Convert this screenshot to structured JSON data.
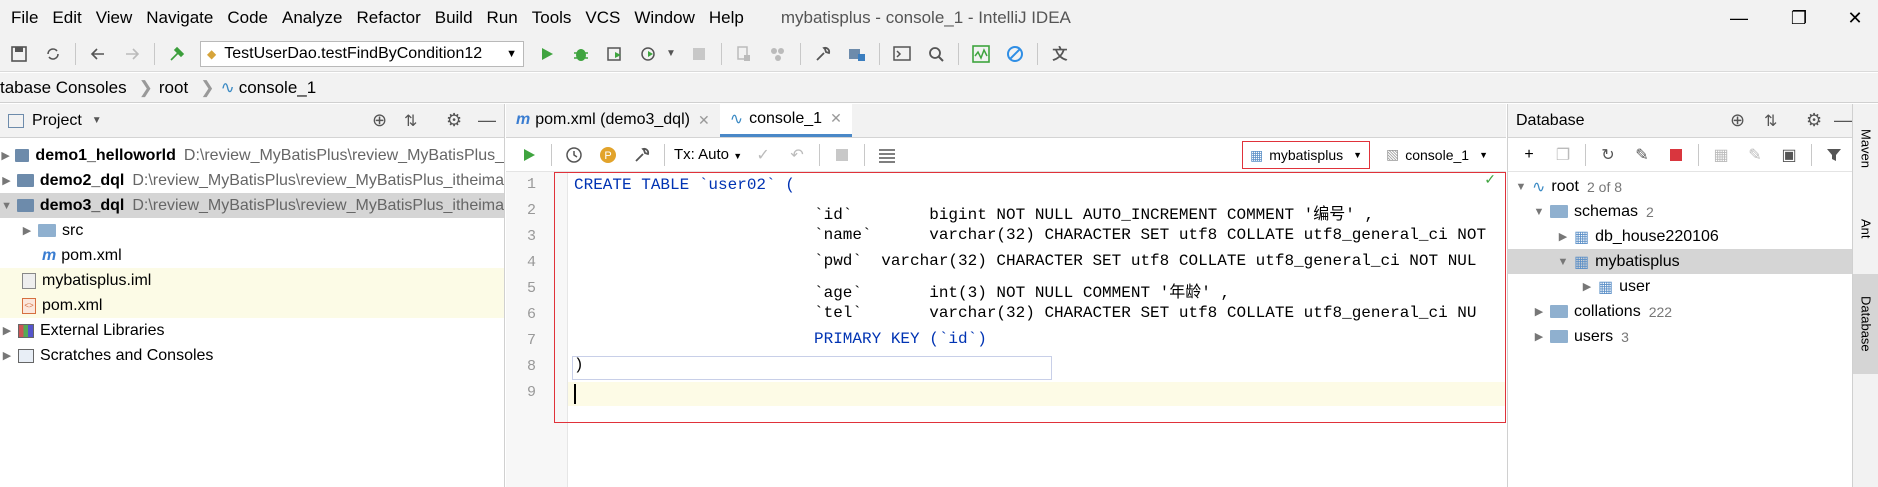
{
  "menu": [
    "File",
    "Edit",
    "View",
    "Navigate",
    "Code",
    "Analyze",
    "Refactor",
    "Build",
    "Run",
    "Tools",
    "VCS",
    "Window",
    "Help"
  ],
  "window_title": "mybatisplus - console_1 - IntelliJ IDEA",
  "run_config": "TestUserDao.testFindByCondition12",
  "breadcrumb": [
    "tabase Consoles",
    "root",
    "console_1"
  ],
  "project": {
    "title": "Project",
    "items": [
      {
        "name": "demo1_helloworld",
        "path": "D:\\review_MyBatisPlus\\review_MyBatisPlus_"
      },
      {
        "name": "demo2_dql",
        "path": "D:\\review_MyBatisPlus\\review_MyBatisPlus_itheima"
      },
      {
        "name": "demo3_dql",
        "path": "D:\\review_MyBatisPlus\\review_MyBatisPlus_itheima"
      },
      {
        "name": "src"
      },
      {
        "name": "pom.xml"
      },
      {
        "name": "mybatisplus.iml"
      },
      {
        "name": "pom.xml"
      },
      {
        "name": "External Libraries"
      },
      {
        "name": "Scratches and Consoles"
      }
    ]
  },
  "tabs": [
    {
      "label": "pom.xml (demo3_dql)"
    },
    {
      "label": "console_1"
    }
  ],
  "console_toolbar": {
    "tx": "Tx: Auto",
    "datasource": "mybatisplus",
    "console": "console_1"
  },
  "code_lines": [
    "CREATE TABLE `user02` (",
    "`id`        bigint NOT NULL AUTO_INCREMENT COMMENT '编号' ,",
    "`name`      varchar(32) CHARACTER SET utf8 COLLATE utf8_general_ci NOT",
    "`pwd`  varchar(32) CHARACTER SET utf8 COLLATE utf8_general_ci NOT NUL",
    "`age`       int(3) NOT NULL COMMENT '年龄' ,",
    "`tel`       varchar(32) CHARACTER SET utf8 COLLATE utf8_general_ci NU",
    "PRIMARY KEY (`id`)",
    ")",
    ""
  ],
  "line_numbers": [
    "1",
    "2",
    "3",
    "4",
    "5",
    "6",
    "7",
    "8",
    "9"
  ],
  "database": {
    "title": "Database",
    "root": {
      "label": "root",
      "count": "2 of 8"
    },
    "schemas": {
      "label": "schemas",
      "count": "2"
    },
    "db1": "db_house220106",
    "db2": "mybatisplus",
    "table": "user",
    "collations": {
      "label": "collations",
      "count": "222"
    },
    "users": {
      "label": "users",
      "count": "3"
    }
  },
  "side_tabs": [
    "Maven",
    "Ant",
    "Database"
  ]
}
